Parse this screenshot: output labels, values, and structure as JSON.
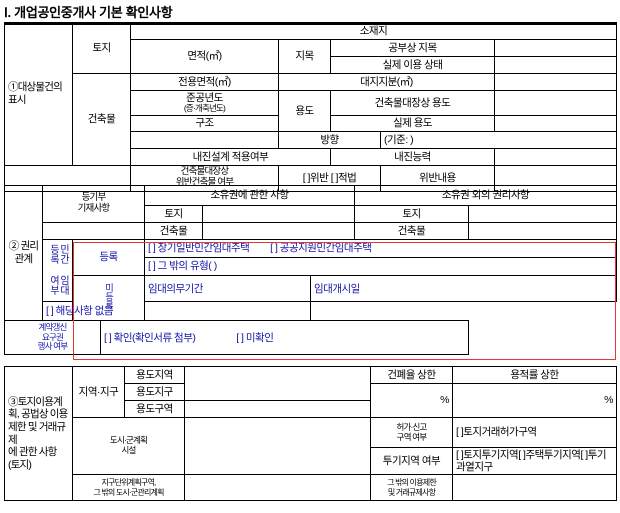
{
  "title": "Ⅰ. 개업공인중개사 기본 확인사항",
  "section1": {
    "label": "①대상물건의 표시",
    "rows": {
      "land_label": "토지",
      "building_label": "건축물",
      "소재지": "소재지",
      "면적": "면적(㎡)",
      "지목": "지목",
      "공부상지목": "공부상 지목",
      "실제이용상태": "실제 이용 상태",
      "전용면적": "전용면적(㎡)",
      "대지지분": "대지지분(㎡)",
      "준공연도": "준공년도\n(증·개축년도)",
      "준공연도_l1": "준공년도",
      "준공연도_l2": "(증·개축년도)",
      "용도": "용도",
      "건축물대장상용도": "건축물대장상 용도",
      "실제용도": "실제 용도",
      "구조": "구조",
      "방향": "방향",
      "기준": "(기준:          )",
      "내진설계": "내진설계 적용여부",
      "내진능력": "내진능력",
      "위반건축물": "건축물대장상\n위반건축물 여부",
      "위반건축물_l1": "건축물대장상",
      "위반건축물_l2": "위반건축물 여부",
      "위반체크": "[  ]위반  [  ]적법",
      "위반내용": "위반내용"
    }
  },
  "section2": {
    "label": "② 권리관계",
    "registry_label": "등기부\n기재사항",
    "registry_l1": "등기부",
    "registry_l2": "기재사항",
    "ownership_header": "소유권에 관한 사항",
    "other_header": "소유권 외의 권리사항",
    "land_label": "토지",
    "building_label": "건축물",
    "private_rent_label": "민간임대등록여부",
    "private_rent_vert": "민간\n임대\n등록\n여부",
    "register_label": "등록",
    "register_options": "[  ] 장기일반민간임대주택     [  ] 공공지원민간임대주택",
    "register_opt1": "[  ] 장기일반민간임대주택",
    "register_opt2": "[  ] 공공지원민간임대주택",
    "register_other": "[  ] 그 밖의 유형(                                                        )",
    "rent_period": "임대의무기간",
    "rent_start": "임대개시일",
    "unregister_label": "미등록",
    "unregister_value": "[  ] 해당사항 없음",
    "contract_renewal_label": "계약갱신\n요구권\n행사 여부",
    "contract_renewal_l1": "계약갱신",
    "contract_renewal_l2": "요구권",
    "contract_renewal_l3": "행사 여부",
    "contract_renewal_value": "[  ] 확인(확인서류 첨부)            [  ] 미확인",
    "contract_opt1": "[  ] 확인(확인서류 첨부)",
    "contract_opt2": "[  ] 미확인"
  },
  "section3": {
    "label": "③토지이용계획, 공법상 이용제한 및 거래규제에 관한 사항(토지)",
    "label_lines": [
      "③토지이용계",
      "획, 공법상 이용",
      "제한 및 거래규제",
      "에 관한 사항",
      "(토지)"
    ],
    "zone_label": "지역·지구",
    "use_area": "용도지역",
    "use_district": "용도지구",
    "use_zone": "용도구역",
    "building_ratio": "건폐율 상한",
    "floor_ratio": "용적률 상한",
    "percent": "%",
    "city_plan_label": "도시·군계획시설",
    "city_plan_l1": "도시·군계획",
    "city_plan_l2": "시설",
    "permit_label": "허가·신고\n구역 여부",
    "permit_l1": "허가·신고",
    "permit_l2": "구역 여부",
    "permit_value": "[  ]토지거래허가구역",
    "speculation_label": "투기지역 여부",
    "speculation_value": "[  ]토지투기지역[   ]주택투기지역[  ]투기과열지구",
    "speculation_opt1": "[  ]토지투기지역",
    "speculation_opt2": "[   ]주택투기지역",
    "speculation_opt3": "[  ]투기과열지구",
    "district_unit_label": "지구단위계획구역,\n그 밖의 도시·군관리계획",
    "district_unit_l1": "지구단위계획구역,",
    "district_unit_l2": "그 밖의 도시·군관리계획",
    "other_label": "그 밖의 이용제한\n및 거래규제사항",
    "other_l1": "그 밖의 이용제한",
    "other_l2": "및 거래규제사항"
  },
  "colors": {
    "highlight_border": "#e8372c",
    "blue_text": "#1c1cb0"
  }
}
